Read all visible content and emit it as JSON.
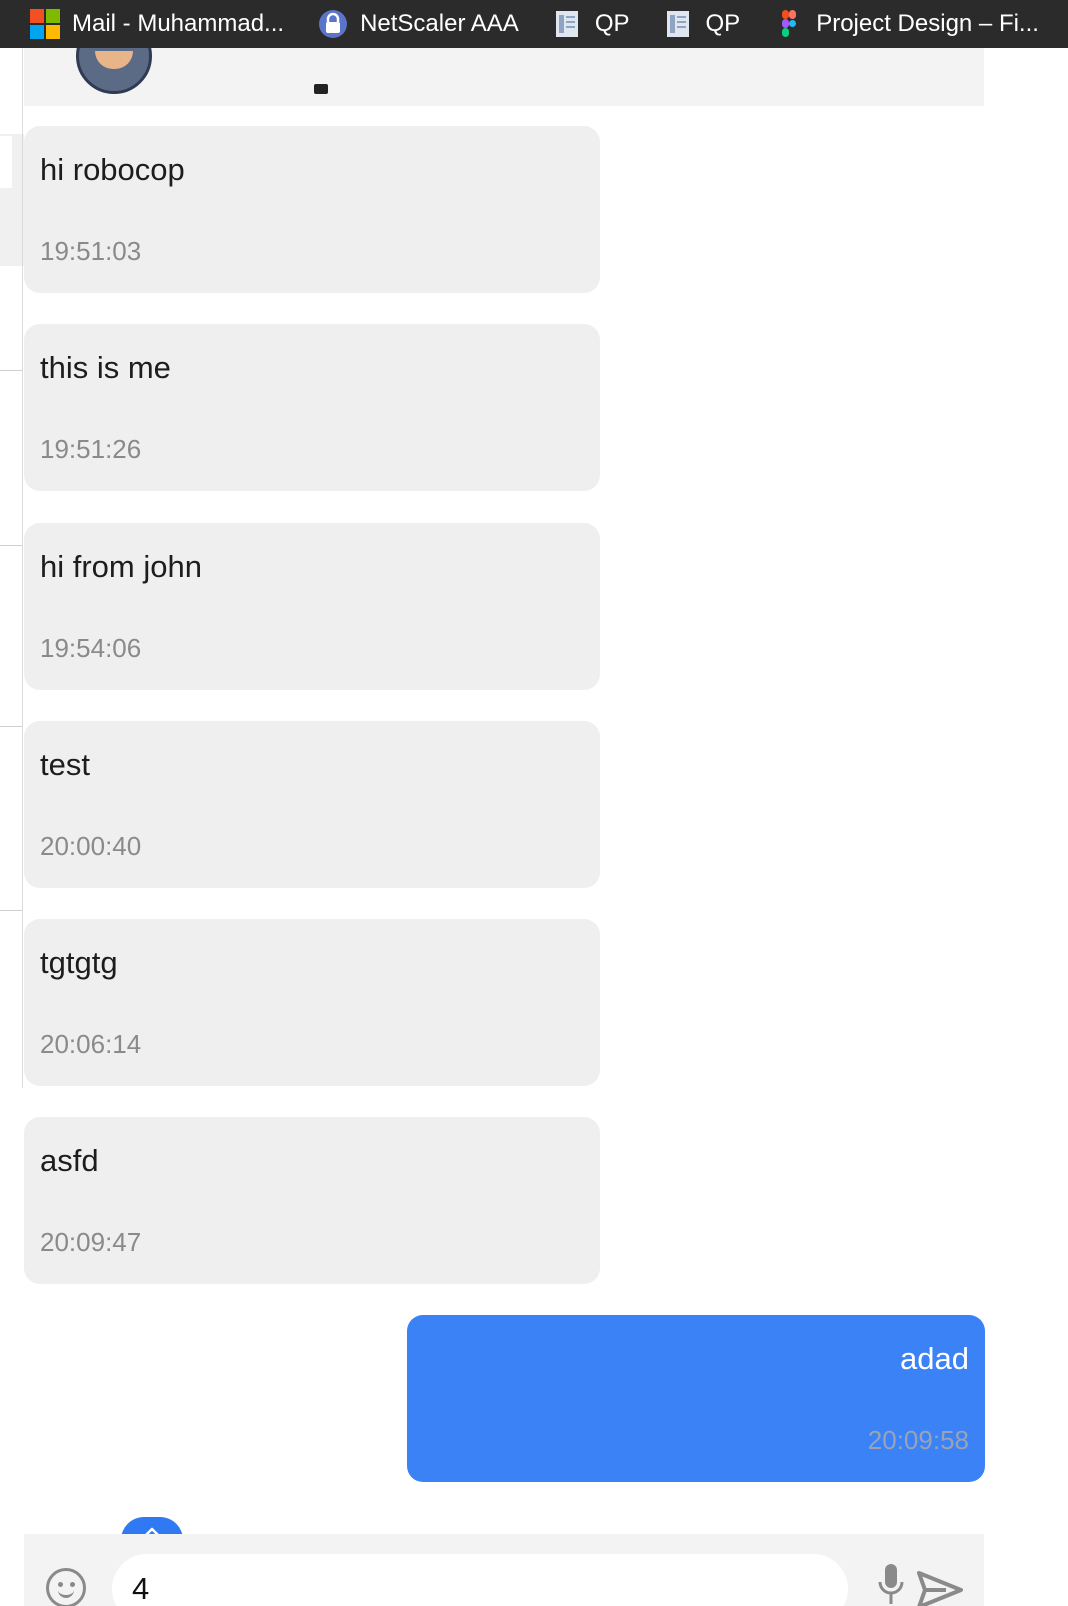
{
  "bookmarks": [
    {
      "label": "Mail - Muhammad...",
      "icon": "microsoft-icon"
    },
    {
      "label": "NetScaler AAA",
      "icon": "lock-icon"
    },
    {
      "label": "QP",
      "icon": "document-icon"
    },
    {
      "label": "QP",
      "icon": "document-icon"
    },
    {
      "label": "Project Design – Fi...",
      "icon": "figma-icon"
    }
  ],
  "chat": {
    "avatar_icon": "avatar",
    "messages": [
      {
        "text": "hi robocop",
        "time": "19:51:03",
        "direction": "received"
      },
      {
        "text": "this is me",
        "time": "19:51:26",
        "direction": "received"
      },
      {
        "text": "hi from john",
        "time": "19:54:06",
        "direction": "received"
      },
      {
        "text": "test",
        "time": "20:00:40",
        "direction": "received"
      },
      {
        "text": "tgtgtg",
        "time": "20:06:14",
        "direction": "received"
      },
      {
        "text": "asfd",
        "time": "20:09:47",
        "direction": "received"
      },
      {
        "text": "adad",
        "time": "20:09:58",
        "direction": "sent"
      }
    ]
  },
  "composer": {
    "input_value": "4",
    "emoji_icon": "emoji-icon",
    "mic_icon": "microphone-icon",
    "send_icon": "send-icon",
    "scroll_icon": "scroll-up-icon"
  },
  "colors": {
    "sent_bubble": "#3b82f6",
    "received_bubble": "#efefef",
    "accent": "#2f7af2",
    "bookmarks_bar": "#2b2b2b"
  }
}
